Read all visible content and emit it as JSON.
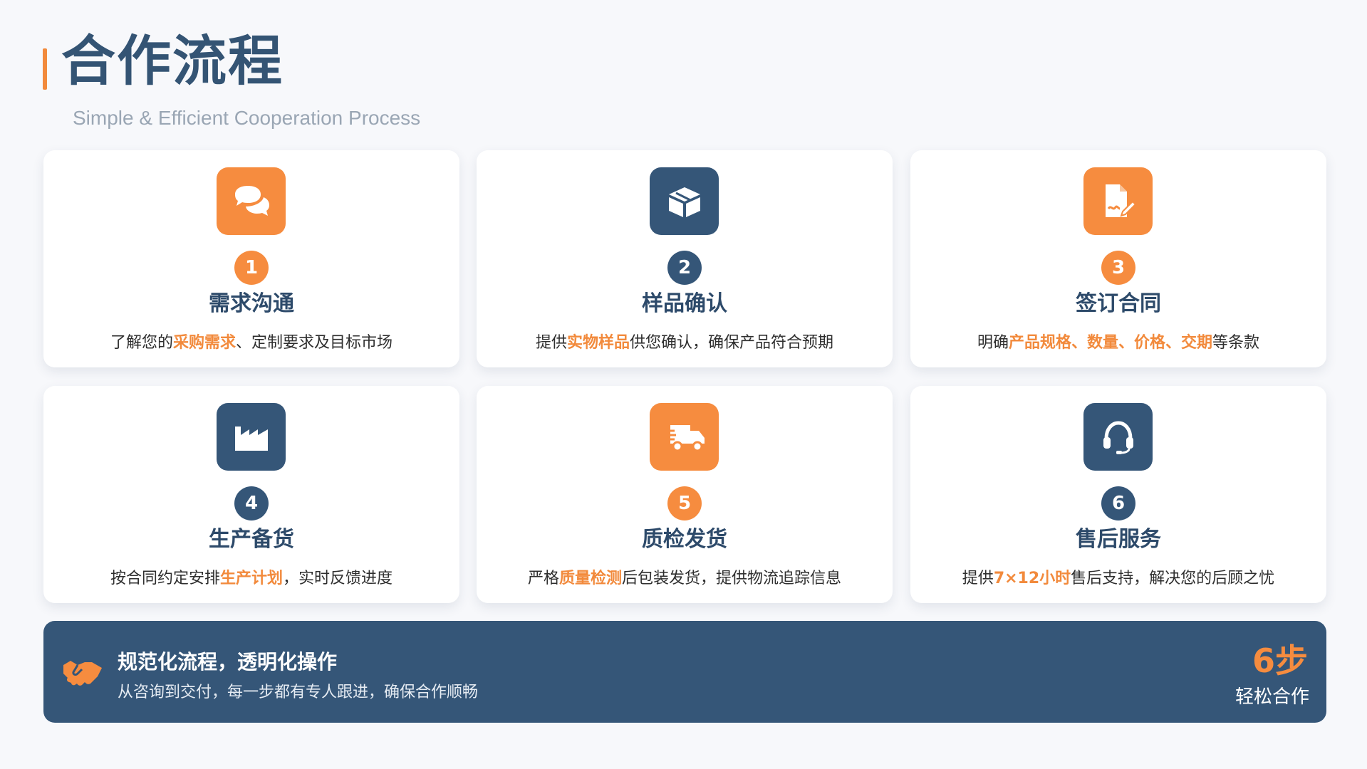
{
  "header": {
    "title": "合作流程",
    "subtitle": "Simple & Efficient Cooperation Process"
  },
  "colors": {
    "accent": "#f68c3f",
    "navy": "#355678",
    "title": "#345474"
  },
  "steps": [
    {
      "number": "1",
      "title": "需求沟通",
      "icon": "chat-bubbles-icon",
      "color": "orange",
      "desc_pre": "了解您的",
      "desc_hl": "采购需求",
      "desc_post": "、定制要求及目标市场"
    },
    {
      "number": "2",
      "title": "样品确认",
      "icon": "box-icon",
      "color": "navy",
      "desc_pre": "提供",
      "desc_hl": "实物样品",
      "desc_post": "供您确认，确保产品符合预期"
    },
    {
      "number": "3",
      "title": "签订合同",
      "icon": "contract-sign-icon",
      "color": "orange",
      "desc_pre": "明确",
      "desc_hl": "产品规格、数量、价格、交期",
      "desc_post": "等条款"
    },
    {
      "number": "4",
      "title": "生产备货",
      "icon": "factory-icon",
      "color": "navy",
      "desc_pre": "按合同约定安排",
      "desc_hl": "生产计划",
      "desc_post": "，实时反馈进度"
    },
    {
      "number": "5",
      "title": "质检发货",
      "icon": "truck-icon",
      "color": "orange",
      "desc_pre": "严格",
      "desc_hl": "质量检测",
      "desc_post": "后包装发货，提供物流追踪信息"
    },
    {
      "number": "6",
      "title": "售后服务",
      "icon": "headset-icon",
      "color": "navy",
      "desc_pre": "提供",
      "desc_hl": "7×12小时",
      "desc_post": "售后支持，解决您的后顾之忧"
    }
  ],
  "banner": {
    "icon": "handshake-icon",
    "title": "规范化流程，透明化操作",
    "subtitle": "从咨询到交付，每一步都有专人跟进，确保合作顺畅",
    "big": "6步",
    "small": "轻松合作"
  }
}
